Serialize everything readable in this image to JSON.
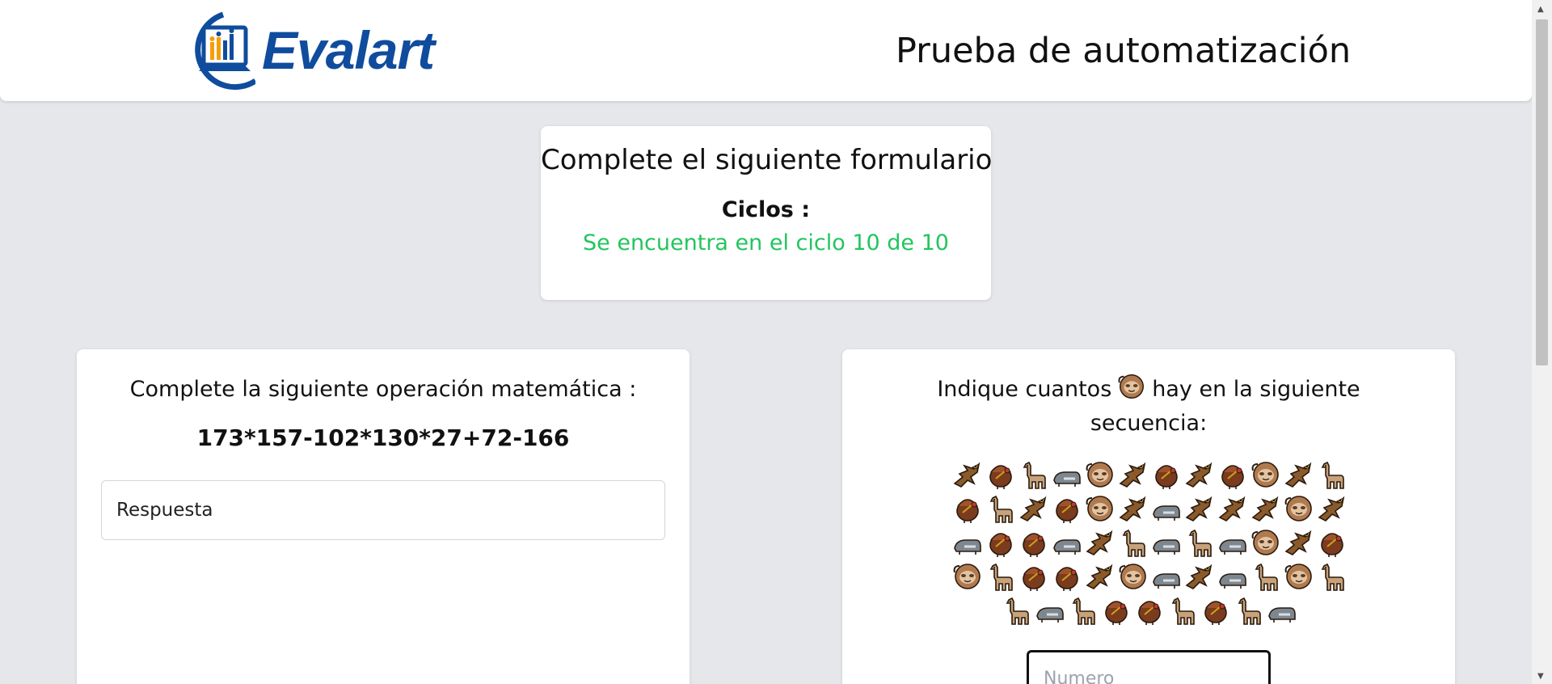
{
  "header": {
    "logo_text": "Evalart",
    "title": "Prueba de automatización"
  },
  "cycle": {
    "heading": "Complete el siguiente formulario",
    "label": "Ciclos :",
    "status": "Se encuentra en el ciclo 10 de 10",
    "status_color": "#22c55e"
  },
  "math": {
    "question": "Complete la siguiente operación matemática :",
    "expression": "173*157-102*130*27+72-166",
    "answer_placeholder": "Respuesta"
  },
  "sequence": {
    "question_before": "Indique cuantos",
    "question_after": "hay en la siguiente secuencia:",
    "target_icon": "sloth",
    "rows": [
      [
        "eagle",
        "turkey",
        "llama",
        "tapir",
        "sloth",
        "eagle",
        "turkey",
        "eagle",
        "turkey",
        "sloth",
        "eagle",
        "llama"
      ],
      [
        "turkey",
        "llama",
        "eagle",
        "turkey",
        "sloth",
        "eagle",
        "tapir",
        "eagle",
        "eagle",
        "eagle",
        "sloth",
        "eagle"
      ],
      [
        "tapir",
        "turkey",
        "turkey",
        "tapir",
        "eagle",
        "llama",
        "tapir",
        "llama",
        "tapir",
        "sloth",
        "eagle",
        "turkey"
      ],
      [
        "sloth",
        "llama",
        "turkey",
        "turkey",
        "eagle",
        "sloth",
        "tapir",
        "eagle",
        "tapir",
        "llama",
        "sloth",
        "llama"
      ],
      [
        "llama",
        "tapir",
        "llama",
        "turkey",
        "turkey",
        "llama",
        "turkey",
        "llama",
        "tapir"
      ]
    ],
    "number_placeholder": "Numero"
  }
}
